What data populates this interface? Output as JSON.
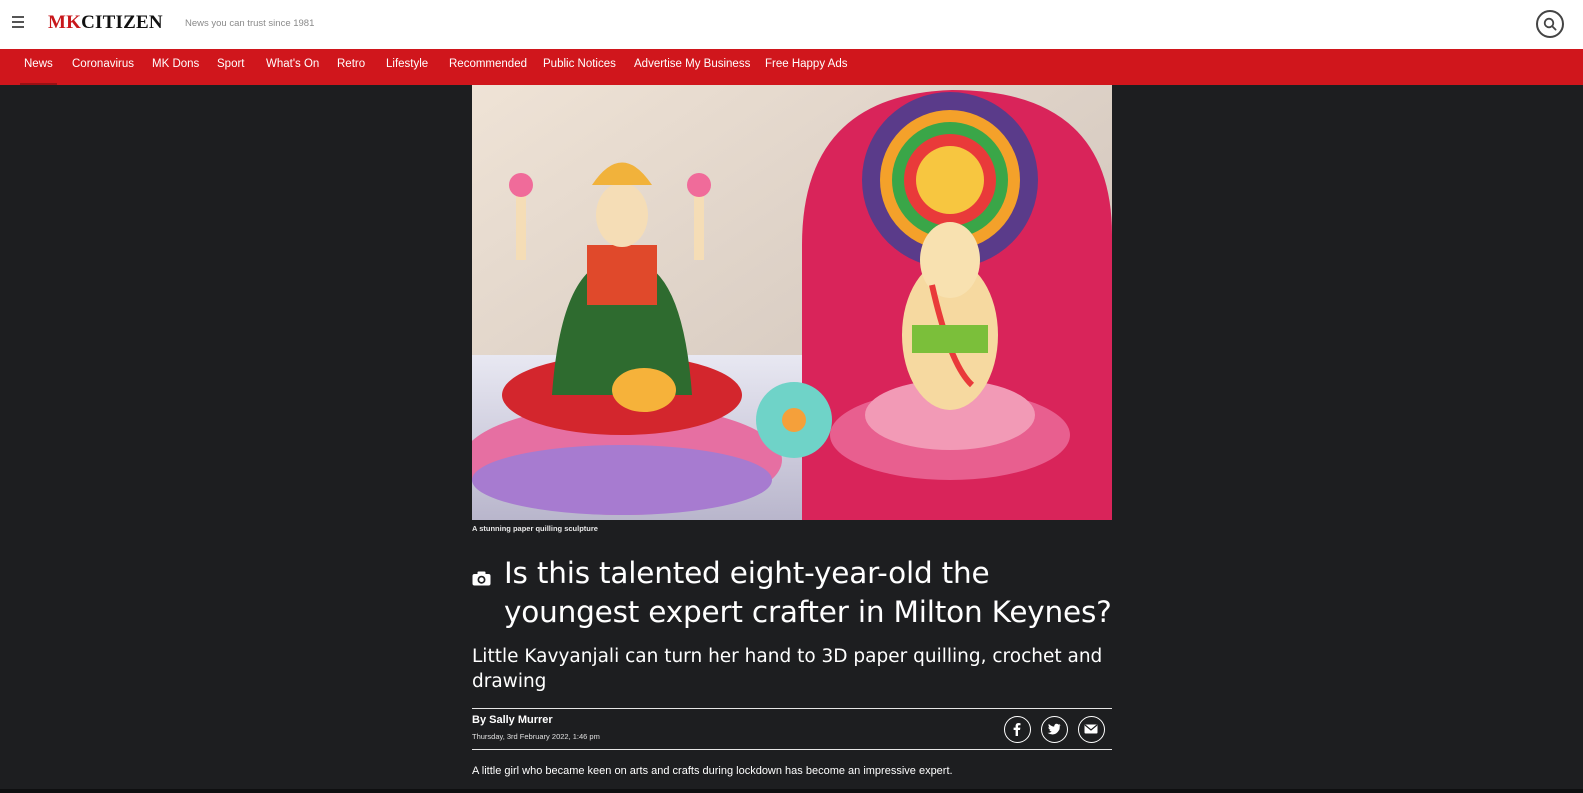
{
  "header": {
    "logo_mk": "MK",
    "logo_citizen": "CITIZEN",
    "tagline": "News you can trust since 1981"
  },
  "nav": {
    "items": [
      {
        "label": "News",
        "active": true
      },
      {
        "label": "Coronavirus"
      },
      {
        "label": "MK Dons"
      },
      {
        "label": "Sport"
      },
      {
        "label": "What's On"
      },
      {
        "label": "Retro"
      },
      {
        "label": "Lifestyle"
      },
      {
        "label": "Recommended"
      },
      {
        "label": "Public Notices"
      },
      {
        "label": "Advertise My Business"
      },
      {
        "label": "Free Happy Ads"
      }
    ]
  },
  "article": {
    "image_caption": "A stunning paper quilling sculpture",
    "headline_line1": "Is this talented eight-year-old the",
    "headline_line2": "youngest expert crafter in Milton Keynes?",
    "standfirst_line1": "Little Kavyanjali can turn her hand to 3D paper quilling, crochet and",
    "standfirst_line2": "drawing",
    "byline": "By Sally Murrer",
    "date": "Thursday, 3rd February 2022, 1:46 pm",
    "lede": "A little girl who became keen on arts and crafts during lockdown has become an impressive expert."
  },
  "share": {
    "icons": [
      "facebook-icon",
      "twitter-icon",
      "email-icon"
    ]
  },
  "colors": {
    "brand_red": "#d0161c",
    "background": "#1d1e20"
  }
}
